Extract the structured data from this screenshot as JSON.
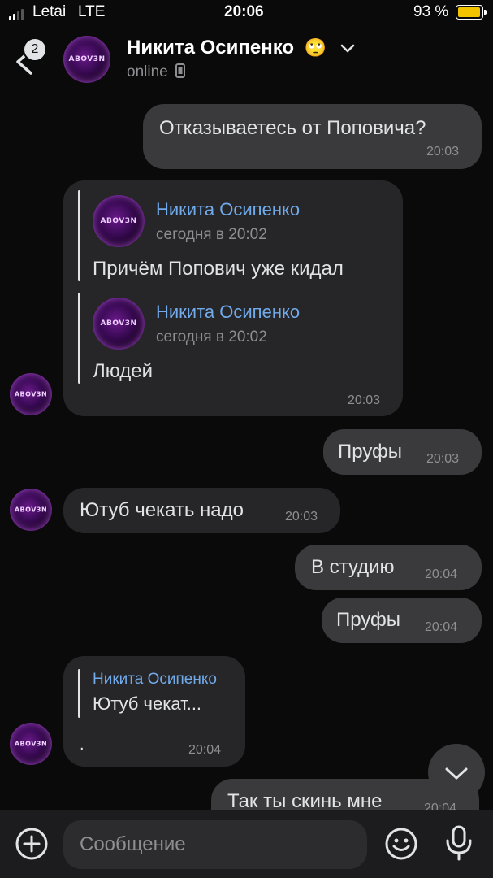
{
  "status_bar": {
    "carrier": "Letai",
    "network": "LTE",
    "time": "20:06",
    "battery": "93 %"
  },
  "header": {
    "unread_count": "2",
    "contact_name": "Никита Осипенко",
    "contact_emoji": "🙄",
    "status": "online",
    "avatar_text": "ABOV3N"
  },
  "messages": [
    {
      "direction": "out",
      "text": "Отказываетесь от Поповича?",
      "time": "20:03"
    },
    {
      "direction": "in",
      "forwarded": [
        {
          "author": "Никита Осипенко",
          "date": "сегодня в 20:02",
          "text": "Причём Попович уже кидал"
        },
        {
          "author": "Никита Осипенко",
          "date": "сегодня в 20:02",
          "text": "Людей"
        }
      ],
      "time": "20:03"
    },
    {
      "direction": "out",
      "text": "Пруфы",
      "time": "20:03"
    },
    {
      "direction": "in",
      "text": "Ютуб чекать надо",
      "time": "20:03"
    },
    {
      "direction": "out",
      "text": "В студию",
      "time": "20:04"
    },
    {
      "direction": "out",
      "text": "Пруфы",
      "time": "20:04"
    },
    {
      "direction": "in",
      "reply_author": "Никита Осипенко",
      "reply_text": "Ютуб чекат...",
      "text": ".",
      "time": "20:04"
    },
    {
      "direction": "out",
      "text": "Так ты скинь мне",
      "time": "20:04"
    }
  ],
  "composer": {
    "placeholder": "Сообщение"
  },
  "icons": {
    "back": "chevron-left-icon",
    "dropdown": "chevron-down-icon",
    "device": "phone-icon",
    "scroll_down": "chevron-down-icon",
    "attach": "plus-circle-icon",
    "emoji": "smile-icon",
    "mic": "microphone-icon"
  },
  "colors": {
    "background": "#0a0a0a",
    "incoming": "#262628",
    "outgoing": "#3a3a3c",
    "link": "#71aaeb",
    "battery": "#f5c400"
  }
}
